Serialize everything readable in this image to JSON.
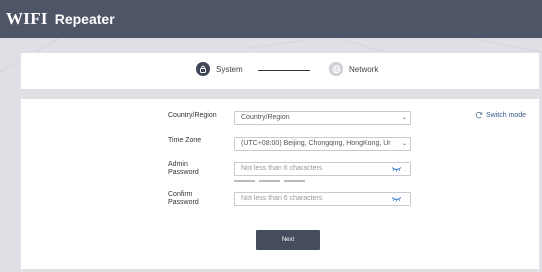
{
  "header": {
    "brand_strong": "WIFI",
    "brand_rest": "Repeater"
  },
  "stepper": {
    "steps": [
      {
        "label": "System",
        "icon": "lock-icon",
        "active": true
      },
      {
        "label": "Network",
        "icon": "globe-icon",
        "active": false
      }
    ]
  },
  "form": {
    "country": {
      "label": "Country/Region",
      "value": "Country/Region"
    },
    "timezone": {
      "label": "Time Zone",
      "value": "(UTC+08:00) Beijing, Chongqing, HongKong, Ur"
    },
    "admin_password": {
      "label_line1": "Admin",
      "label_line2": "Password",
      "placeholder": "Not less than 6 characters"
    },
    "confirm_password": {
      "label_line1": "Confirm",
      "label_line2": "Password",
      "placeholder": "Not less than 6 characters"
    },
    "switch_mode": "Switch mode",
    "next_label": "Next"
  },
  "colors": {
    "header_bg": "#4e5567",
    "primary_button": "#454c5d",
    "link": "#3a5a88"
  }
}
